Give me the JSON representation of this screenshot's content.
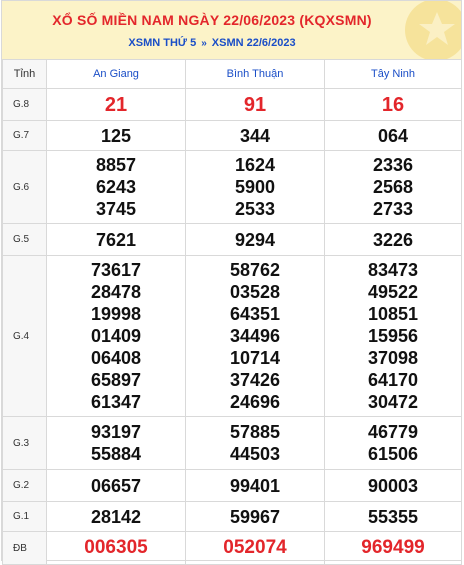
{
  "header": {
    "title": "XỔ SỐ MIỀN NAM NGÀY 22/06/2023 (KQXSMN)",
    "link1": "XSMN THỨ 5",
    "separator": "»",
    "link2": "XSMN 22/6/2023",
    "bg_color": "#fcf3c8",
    "title_color": "#e3262b",
    "link_color": "#1a4ec7"
  },
  "table": {
    "label_header": "Tỉnh",
    "provinces": [
      "An Giang",
      "Bình Thuận",
      "Tây Ninh"
    ],
    "rows": [
      {
        "label": "G.8",
        "values": [
          [
            "21"
          ],
          [
            "91"
          ],
          [
            "16"
          ]
        ]
      },
      {
        "label": "G.7",
        "values": [
          [
            "125"
          ],
          [
            "344"
          ],
          [
            "064"
          ]
        ]
      },
      {
        "label": "G.6",
        "values": [
          [
            "8857",
            "6243",
            "3745"
          ],
          [
            "1624",
            "5900",
            "2533"
          ],
          [
            "2336",
            "2568",
            "2733"
          ]
        ]
      },
      {
        "label": "G.5",
        "values": [
          [
            "7621"
          ],
          [
            "9294"
          ],
          [
            "3226"
          ]
        ]
      },
      {
        "label": "G.4",
        "values": [
          [
            "73617",
            "28478",
            "19998",
            "01409",
            "06408",
            "65897",
            "61347"
          ],
          [
            "58762",
            "03528",
            "64351",
            "34496",
            "10714",
            "37426",
            "24696"
          ],
          [
            "83473",
            "49522",
            "10851",
            "15956",
            "37098",
            "64170",
            "30472"
          ]
        ]
      },
      {
        "label": "G.3",
        "values": [
          [
            "93197",
            "55884"
          ],
          [
            "57885",
            "44503"
          ],
          [
            "46779",
            "61506"
          ]
        ]
      },
      {
        "label": "G.2",
        "values": [
          [
            "06657"
          ],
          [
            "99401"
          ],
          [
            "90003"
          ]
        ]
      },
      {
        "label": "G.1",
        "values": [
          [
            "28142"
          ],
          [
            "59967"
          ],
          [
            "55355"
          ]
        ]
      },
      {
        "label": "ĐB",
        "values": [
          [
            "006305"
          ],
          [
            "052074"
          ],
          [
            "969499"
          ]
        ]
      }
    ]
  }
}
